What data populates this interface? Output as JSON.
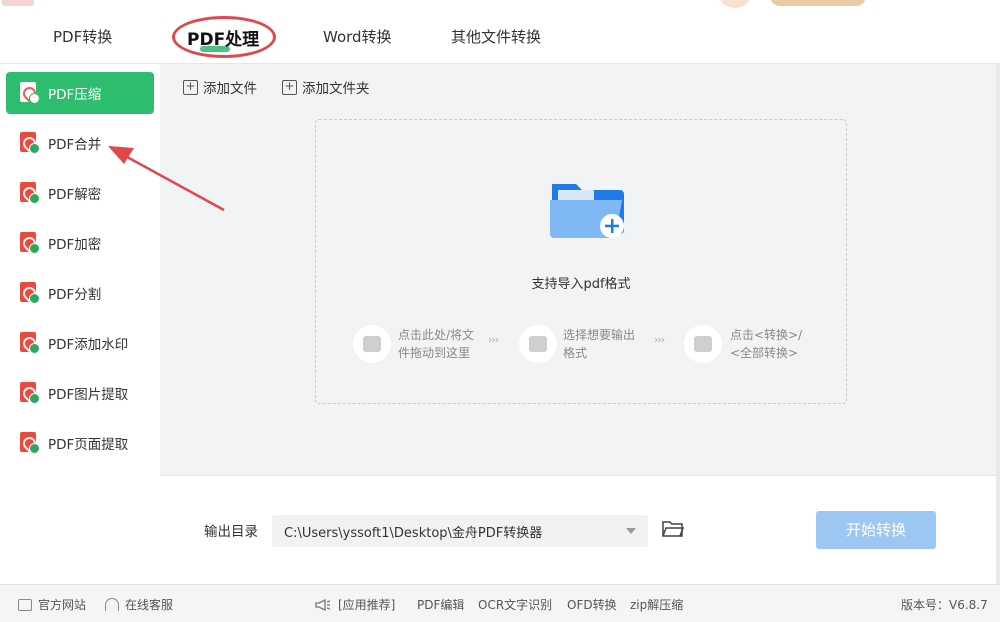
{
  "tabs": [
    {
      "label": "PDF转换"
    },
    {
      "label": "PDF处理"
    },
    {
      "label": "Word转换"
    },
    {
      "label": "其他文件转换"
    }
  ],
  "sidebar": {
    "items": [
      {
        "label": "PDF压缩"
      },
      {
        "label": "PDF合并"
      },
      {
        "label": "PDF解密"
      },
      {
        "label": "PDF加密"
      },
      {
        "label": "PDF分割"
      },
      {
        "label": "PDF添加水印"
      },
      {
        "label": "PDF图片提取"
      },
      {
        "label": "PDF页面提取"
      }
    ]
  },
  "toolbar": {
    "add_file": "添加文件",
    "add_folder": "添加文件夹"
  },
  "dropzone": {
    "hint": "支持导入pdf格式",
    "steps": [
      {
        "line1": "点击此处/将文",
        "line2": "件拖动到这里"
      },
      {
        "line1": "选择想要输出",
        "line2": "格式"
      },
      {
        "line1": "点击<转换>/",
        "line2": "<全部转换>"
      }
    ],
    "separator": "›››"
  },
  "output": {
    "label": "输出目录",
    "path": "C:\\Users\\yssoft1\\Desktop\\金舟PDF转换器",
    "start_button": "开始转换"
  },
  "statusbar": {
    "website": "官方网站",
    "support": "在线客服",
    "recommend": "[应用推荐]",
    "links": [
      "PDF编辑",
      "OCR文字识别",
      "OFD转换",
      "zip解压缩"
    ],
    "version": "版本号：V6.8.7"
  },
  "colors": {
    "accent_green": "#2cbd6f",
    "start_button": "#9cc7f3",
    "annotation_red": "#e0484b",
    "pdf_red": "#e94a3f"
  }
}
